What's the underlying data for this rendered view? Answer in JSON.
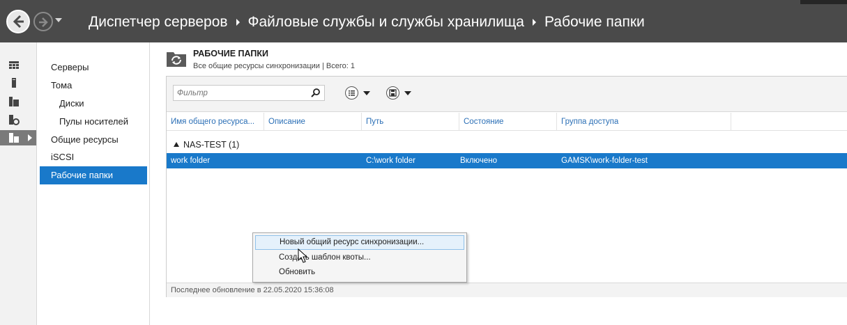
{
  "titlebar": {
    "breadcrumb": [
      "Диспетчер серверов",
      "Файловые службы и службы хранилища",
      "Рабочие папки"
    ]
  },
  "rail": {
    "icons": [
      "dashboard-icon",
      "server-icon",
      "all-servers-icon",
      "storage-pool-icon",
      "file-services-icon"
    ]
  },
  "nav": {
    "items": [
      {
        "label": "Серверы"
      },
      {
        "label": "Тома"
      },
      {
        "label": "Диски"
      },
      {
        "label": "Пулы носителей"
      },
      {
        "label": "Общие ресурсы"
      },
      {
        "label": "iSCSI"
      },
      {
        "label": "Рабочие папки"
      }
    ],
    "selected": "Рабочие папки"
  },
  "header": {
    "title": "РАБОЧИЕ ПАПКИ",
    "subtitle": "Все общие ресурсы синхронизации | Всего: 1"
  },
  "toolbar": {
    "filter_placeholder": "Фильтр"
  },
  "table": {
    "columns": [
      "Имя общего ресурса...",
      "Описание",
      "Путь",
      "Состояние",
      "Группа доступа"
    ],
    "group": "NAS-TEST (1)",
    "rows": [
      {
        "name": "work folder",
        "description": "",
        "path": "C:\\work folder",
        "state": "Включено",
        "group": "GAMSK\\work-folder-test"
      }
    ]
  },
  "status": {
    "text": "Последнее обновление в 22.05.2020 15:36:08"
  },
  "context_menu": {
    "items": [
      {
        "label": "Новый общий ресурс синхронизации..."
      },
      {
        "label": "Создать шаблон квоты..."
      },
      {
        "label": "Обновить"
      }
    ]
  },
  "colors": {
    "titlebar": "#4a4a4a",
    "selection": "#1979ca",
    "column_header_text": "#2b6fb6"
  }
}
